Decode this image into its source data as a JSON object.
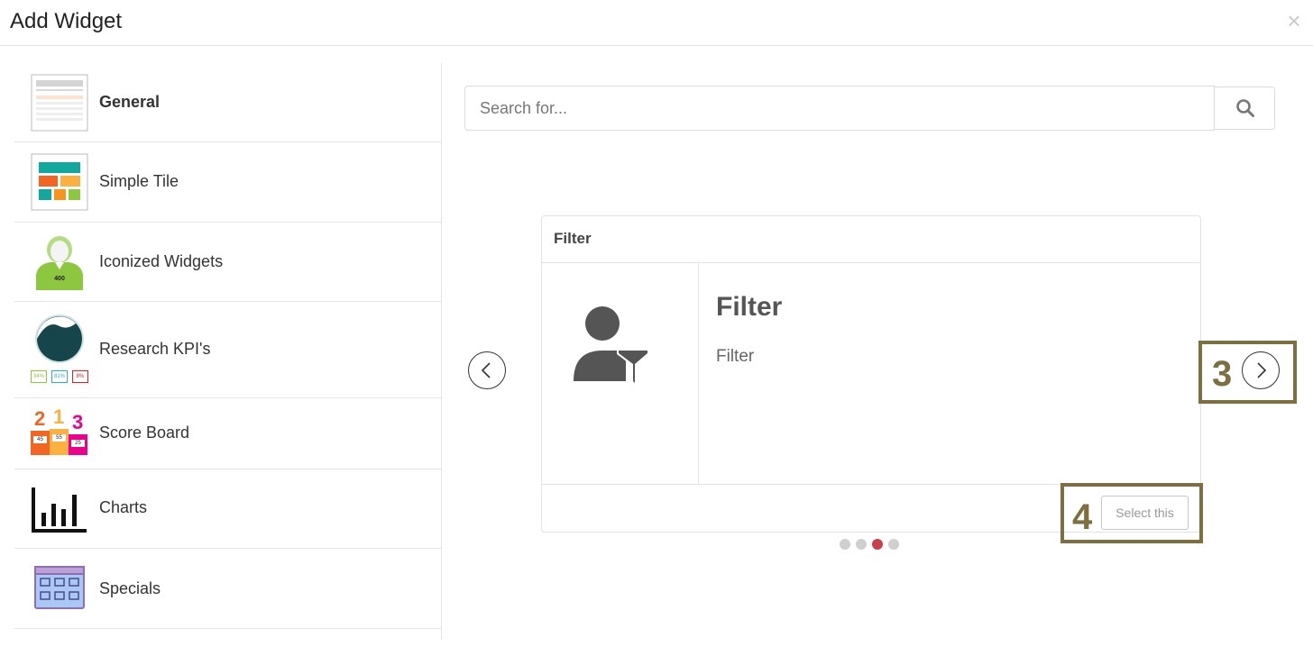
{
  "dialog": {
    "title": "Add Widget",
    "close_icon": "close-icon"
  },
  "sidebar": {
    "items": [
      {
        "label": "General",
        "icon": "general-thumbnail",
        "active": true
      },
      {
        "label": "Simple Tile",
        "icon": "simple-tile-thumbnail",
        "active": false
      },
      {
        "label": "Iconized Widgets",
        "icon": "iconized-widgets-thumbnail",
        "active": false
      },
      {
        "label": "Research KPI's",
        "icon": "research-kpi-thumbnail",
        "active": false
      },
      {
        "label": "Score Board",
        "icon": "score-board-thumbnail",
        "active": false
      },
      {
        "label": "Charts",
        "icon": "charts-thumbnail",
        "active": false
      },
      {
        "label": "Specials",
        "icon": "specials-thumbnail",
        "active": false
      }
    ],
    "iconized_widget_value": "400",
    "research_kpi_badges": [
      "34%",
      "81%",
      "8%"
    ],
    "score_board": {
      "ranks": [
        "2",
        "1",
        "3"
      ],
      "scores": [
        "45",
        "55",
        "25"
      ]
    }
  },
  "search": {
    "placeholder": "Search for...",
    "value": "",
    "icon": "search-icon"
  },
  "carousel": {
    "card": {
      "header": "Filter",
      "title": "Filter",
      "description": "Filter",
      "icon": "user-filter-icon",
      "select_label": "Select this"
    },
    "slide_count": 4,
    "active_slide": 3
  },
  "annotations": {
    "next_callout": "3",
    "select_callout": "4"
  },
  "colors": {
    "active_dot": "#c9404a",
    "inactive_dot": "#cfcfcf",
    "callout": "#7d6f3f",
    "tile_teal": "#13a89e",
    "tile_orange": "#f26522",
    "tile_yellow": "#fbb040",
    "tile_green": "#8dc63f"
  }
}
